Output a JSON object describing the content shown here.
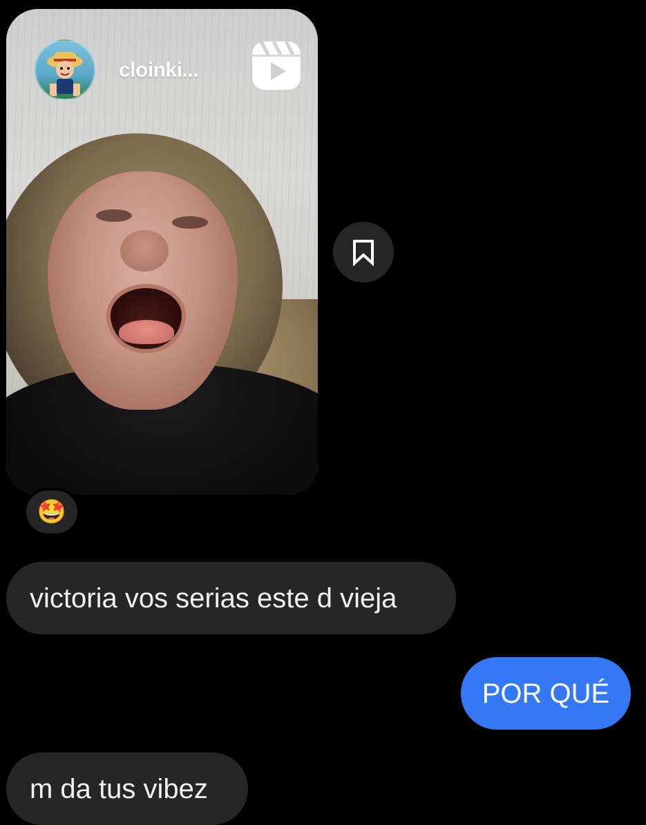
{
  "shared_reel": {
    "username": "cloinki...",
    "avatar_icon": "profile-avatar",
    "type_icon": "reels-icon"
  },
  "save_button": {
    "icon": "bookmark-icon"
  },
  "reaction": {
    "emoji": "🤩"
  },
  "messages": [
    {
      "direction": "received",
      "text": "victoria vos serias este d vieja"
    },
    {
      "direction": "sent",
      "text": "POR QUÉ"
    },
    {
      "direction": "received",
      "text": "m da tus vibez"
    }
  ],
  "colors": {
    "background": "#000000",
    "received_bubble": "#262626",
    "sent_bubble": "#3478f6"
  }
}
